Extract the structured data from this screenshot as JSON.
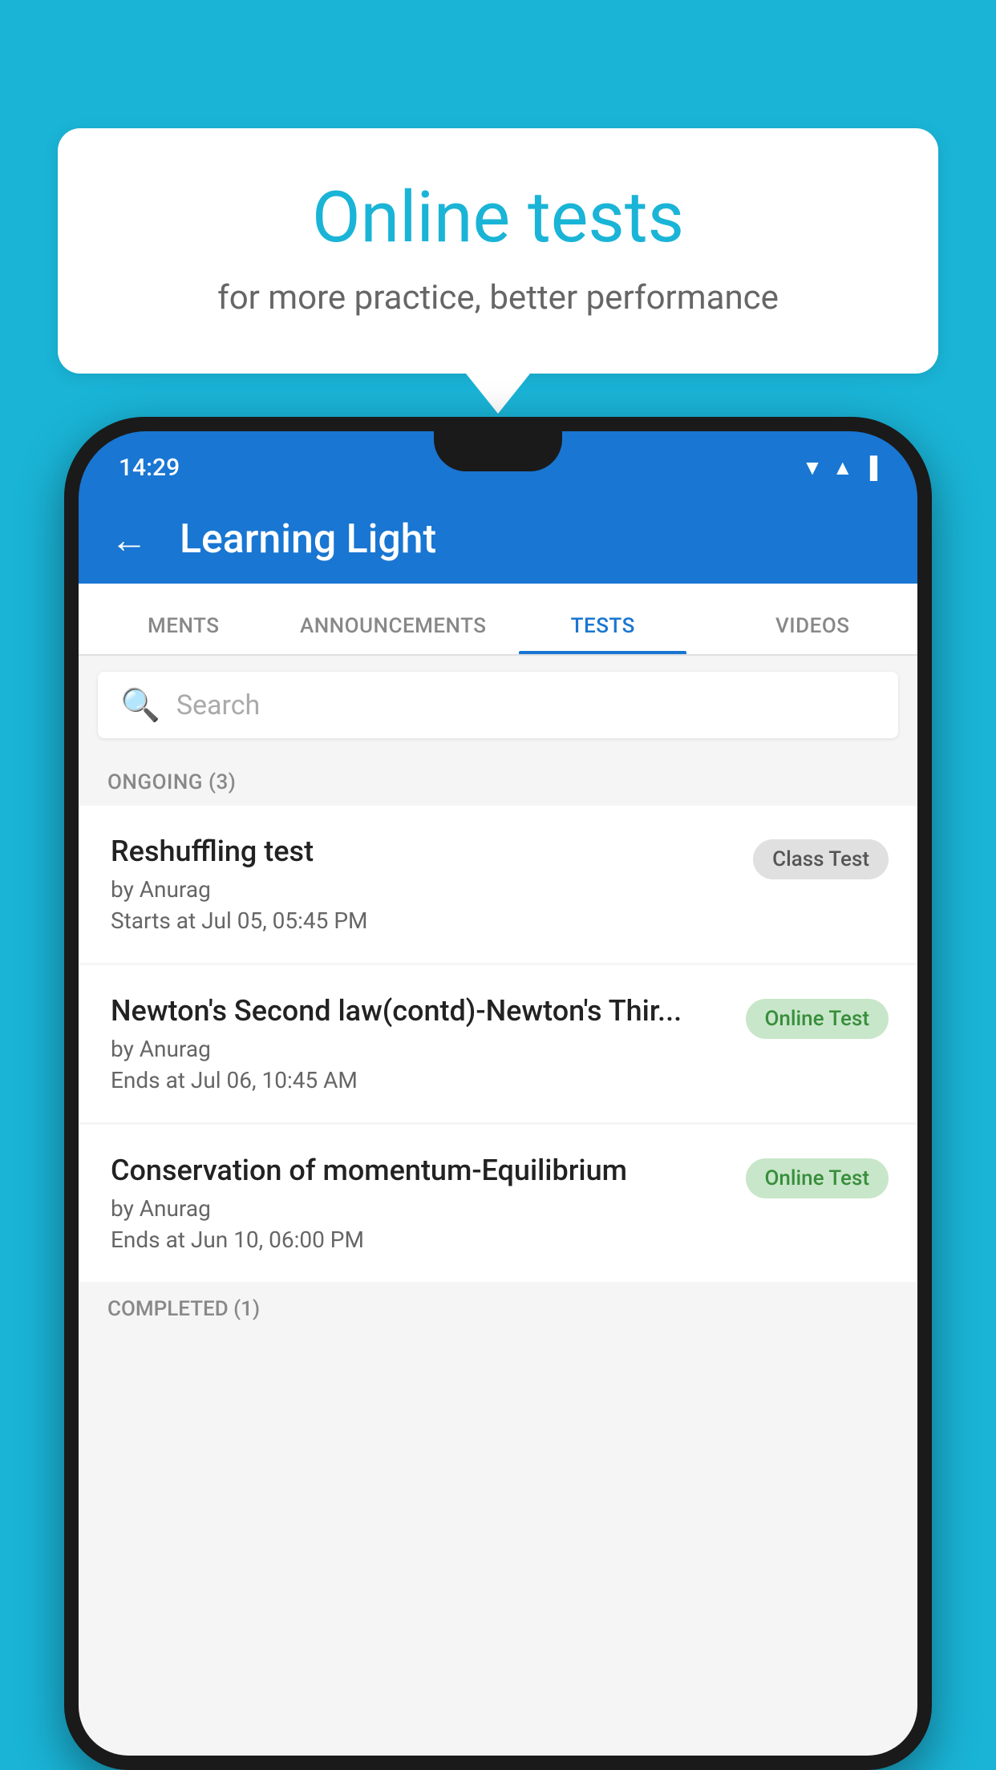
{
  "background_color": "#1ab4d7",
  "speech_bubble": {
    "title": "Online tests",
    "subtitle": "for more practice, better performance"
  },
  "phone": {
    "status_bar": {
      "time": "14:29",
      "icons": "▼▲▐"
    },
    "header": {
      "back_label": "←",
      "title": "Learning Light"
    },
    "tabs": [
      {
        "label": "MENTS",
        "active": false
      },
      {
        "label": "ANNOUNCEMENTS",
        "active": false
      },
      {
        "label": "TESTS",
        "active": true
      },
      {
        "label": "VIDEOS",
        "active": false
      }
    ],
    "search": {
      "placeholder": "Search"
    },
    "sections": [
      {
        "header": "ONGOING (3)",
        "items": [
          {
            "name": "Reshuffling test",
            "by": "by Anurag",
            "time": "Starts at  Jul 05, 05:45 PM",
            "badge": "Class Test",
            "badge_type": "class"
          },
          {
            "name": "Newton's Second law(contd)-Newton's Thir...",
            "by": "by Anurag",
            "time": "Ends at  Jul 06, 10:45 AM",
            "badge": "Online Test",
            "badge_type": "online"
          },
          {
            "name": "Conservation of momentum-Equilibrium",
            "by": "by Anurag",
            "time": "Ends at  Jun 10, 06:00 PM",
            "badge": "Online Test",
            "badge_type": "online"
          }
        ]
      }
    ],
    "completed_section_label": "COMPLETED (1)"
  }
}
